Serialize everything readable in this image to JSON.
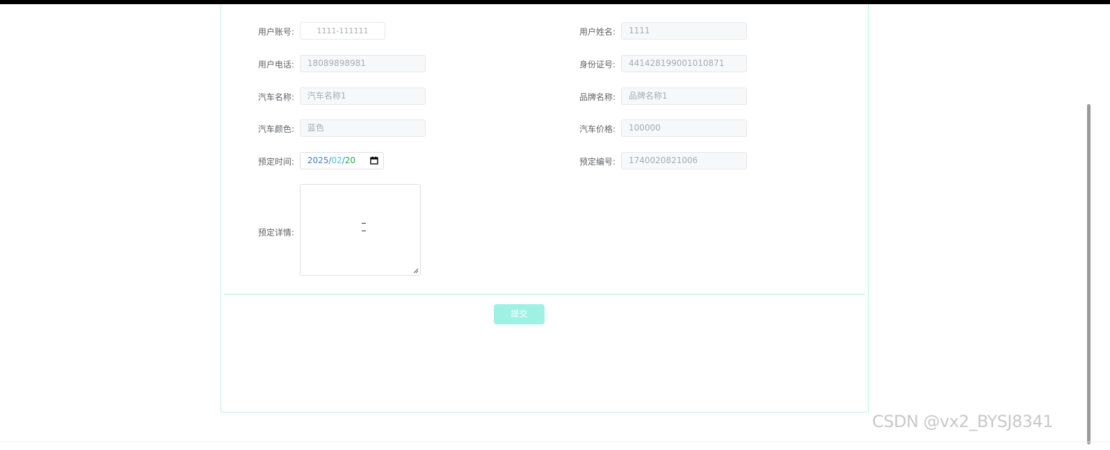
{
  "form": {
    "fields": {
      "account": {
        "label": "用户账号:",
        "value": "1111-111111"
      },
      "name": {
        "label": "用户姓名:",
        "value": "1111"
      },
      "phone": {
        "label": "用户电话:",
        "value": "18089898981"
      },
      "id_card": {
        "label": "身份证号:",
        "value": "441428199001010871"
      },
      "car_name": {
        "label": "汽车名称:",
        "value": "汽车名称1"
      },
      "brand_name": {
        "label": "品牌名称:",
        "value": "品牌名称1"
      },
      "car_color": {
        "label": "汽车颜色:",
        "value": "蓝色"
      },
      "car_price": {
        "label": "汽车价格:",
        "value": "100000"
      },
      "booking_time": {
        "label": "预定时间:",
        "year": "2025",
        "month": "02",
        "day": "20",
        "separator": "/"
      },
      "booking_number": {
        "label": "预定编号:",
        "value": "1740020821006"
      },
      "booking_details": {
        "label": "预定详情:",
        "value": ""
      }
    },
    "submit_label": "提交"
  },
  "watermark": "CSDN @vx2_BYSJ8341",
  "colors": {
    "accent": "#9ff1e3",
    "border": "#bff0e8"
  },
  "icons": [
    "calendar-icon",
    "resize-grip-icon"
  ]
}
